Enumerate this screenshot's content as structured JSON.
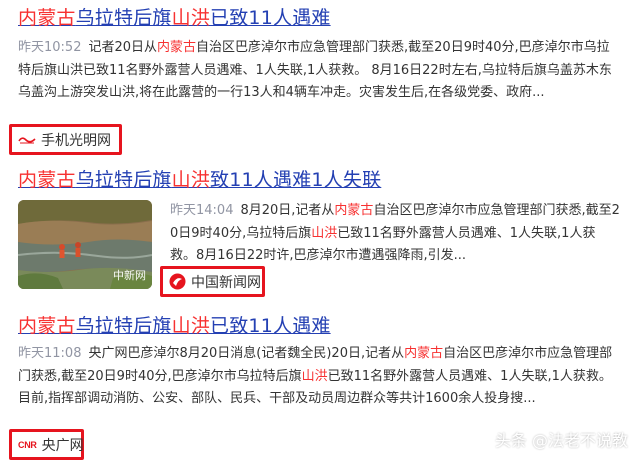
{
  "results": [
    {
      "title_parts": [
        "内蒙古",
        "乌拉特后旗",
        "山洪",
        "已致11人遇难"
      ],
      "time": "昨天10:52",
      "snippet_parts": [
        "记者20日从",
        "内蒙古",
        "自治区巴彦淖尔市应急管理部门获悉,截至20日9时40分,巴彦淖尔市乌拉特后旗山洪已致11名野外露营人员遇难、1人失联,1人获救。 8月16日22时左右,乌拉特后旗乌盖苏木东乌盖沟上游突发山洪,将在此露营的一行13人和4辆车冲走。灾害发生后,在各级党委、政府..."
      ],
      "source": "手机光明网",
      "logo_icon": "guangming-logo-icon"
    },
    {
      "title_parts": [
        "内蒙古",
        "乌拉特后旗",
        "山洪",
        "致11人遇难1人失联"
      ],
      "time": "昨天14:04",
      "snippet_parts": [
        "8月20日,记者从",
        "内蒙古",
        "自治区巴彦淖尔市应急管理部门获悉,截至20日9时40分,乌拉特后旗",
        "山洪",
        "已致11名野外露营人员遇难、1人失联,1人获救。8月16日22时许,巴彦淖尔市遭遇强降雨,引发..."
      ],
      "source": "中国新闻网",
      "logo_icon": "chinanews-logo-icon",
      "thumb_watermark": "中新网"
    },
    {
      "title_parts": [
        "内蒙古",
        "乌拉特后旗",
        "山洪",
        "已致11人遇难"
      ],
      "time": "昨天11:08",
      "snippet_parts": [
        "央广网巴彦淖尔8月20日消息(记者魏全民)20日,记者从",
        "内蒙古",
        "自治区巴彦淖尔市应急管理部门获悉,截至20日9时40分,巴彦淖尔市乌拉特后旗",
        "山洪",
        "已致11名野外露营人员遇难、1人失联,1人获救。目前,指挥部调动消防、公安、部队、民兵、干部及动员周边群众等共计1600余人投身搜..."
      ],
      "source": "央广网",
      "logo_icon": "cnr-logo-icon",
      "logo_text": "CNR"
    }
  ],
  "watermark": {
    "text": "头条 @法老不说教"
  },
  "colors": {
    "title": "#2440b3",
    "highlight": "#f73131",
    "time": "#9195a3",
    "box": "#e6141e"
  }
}
